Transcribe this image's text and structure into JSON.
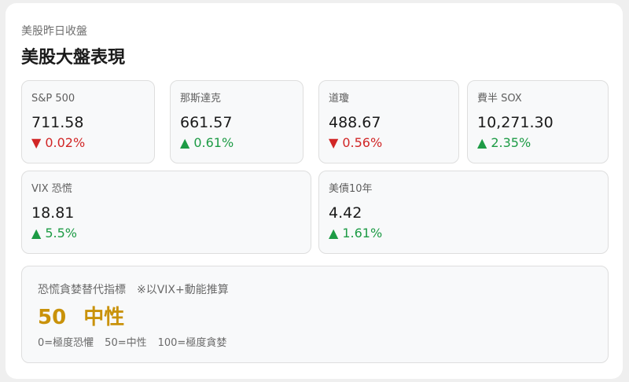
{
  "header": {
    "subtitle": "美股昨日收盤",
    "title": "美股大盤表現"
  },
  "tiles": [
    {
      "label": "S&P 500",
      "value": "711.58",
      "direction": "down",
      "arrow": "▼",
      "change": "0.02%"
    },
    {
      "label": "那斯達克",
      "value": "661.57",
      "direction": "up",
      "arrow": "▲",
      "change": "0.61%"
    },
    {
      "label": "道瓊",
      "value": "488.67",
      "direction": "down",
      "arrow": "▼",
      "change": "0.56%"
    },
    {
      "label": "費半 SOX",
      "value": "10,271.30",
      "direction": "up",
      "arrow": "▲",
      "change": "2.35%"
    },
    {
      "label": "VIX 恐慌",
      "value": "18.81",
      "direction": "up",
      "arrow": "▲",
      "change": "5.5%"
    },
    {
      "label": "美債10年",
      "value": "4.42",
      "direction": "up",
      "arrow": "▲",
      "change": "1.61%"
    }
  ],
  "fear_greed": {
    "title": "恐慌貪婪替代指標",
    "note": "※以VIX+動能推算",
    "score": "50",
    "label": "中性",
    "legend": [
      "0=極度恐懼",
      "50=中性",
      "100=極度貪婪"
    ]
  },
  "colors": {
    "up": "#1d9b45",
    "down": "#d12626",
    "neutral": "#c9920a"
  }
}
